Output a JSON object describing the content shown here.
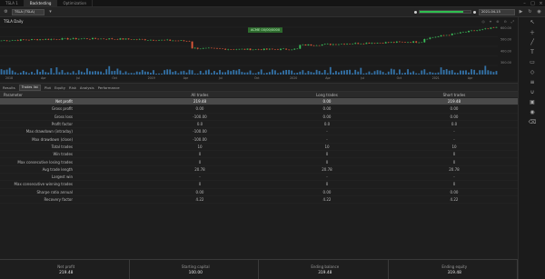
{
  "tabs": [
    {
      "label": "TSLA 1",
      "active": false
    },
    {
      "label": "Backtesting",
      "active": true
    },
    {
      "label": "Optimization",
      "active": false
    }
  ],
  "toolbar": {
    "symbol": "TSLA (TSLA)",
    "date": "2021-04-15",
    "progress": 0.85
  },
  "chart": {
    "title": "TSLA Daily",
    "tag": "ACME 00/00/0000",
    "controls": [
      "◎",
      "⌖",
      "⊕",
      "⊖",
      "⤢"
    ],
    "price_axis": [
      "600.00",
      "500.00",
      "400.00",
      "300.00"
    ],
    "time_axis": [
      "2018",
      "Apr",
      "Jul",
      "Oct",
      "2019",
      "Apr",
      "Jul",
      "Oct",
      "2020",
      "Apr",
      "Jul",
      "Oct",
      "2021",
      "Apr"
    ],
    "colors": {
      "up": "#3bbf5a",
      "down": "#e05a3a",
      "volume": "#3a87c9",
      "grid": "#2a2a2a"
    }
  },
  "results_toolbar": {
    "items": [
      "Results",
      "Trades list",
      "Plot",
      "Equity",
      "Risk",
      "Analysis",
      "Performance"
    ],
    "selected": "Trades list"
  },
  "table": {
    "headers": [
      "Parameter",
      "All trades",
      "Long trades",
      "Short trades"
    ],
    "rows": [
      {
        "label": "Net profit",
        "values": [
          "219.48",
          "0.00",
          "219.48"
        ],
        "indent": true,
        "selected": true
      },
      {
        "label": "Gross profit",
        "values": [
          "0.00",
          "0.00",
          "0.00"
        ],
        "indent": true
      },
      {
        "label": "Gross loss",
        "values": [
          "-100.00",
          "0.00",
          "0.00"
        ],
        "indent": true
      },
      {
        "label": "Profit factor",
        "values": [
          "0.0",
          "0.0",
          "0.0"
        ],
        "indent": true
      },
      {
        "label": "Max drawdown (intraday)",
        "values": [
          "-100.00",
          "-",
          "-"
        ],
        "indent": true
      },
      {
        "label": "Max drawdown (close)",
        "values": [
          "-100.00",
          "-",
          "-"
        ],
        "indent": true
      },
      {
        "label": "Total trades",
        "values": [
          "10",
          "10",
          "10"
        ],
        "indent": true
      },
      {
        "label": "Win trades",
        "values": [
          "0",
          "0",
          "0"
        ],
        "indent": true
      },
      {
        "label": "Max consecutive losing trades",
        "values": [
          "0",
          "0",
          "0"
        ],
        "indent": true
      },
      {
        "label": "Avg trade length",
        "values": [
          "20.78",
          "20.78",
          "20.78"
        ],
        "indent": true
      },
      {
        "label": "Largest win",
        "values": [
          "-",
          "-",
          "-"
        ],
        "indent": true
      },
      {
        "label": "Max consecutive winning trades",
        "values": [
          "0",
          "0",
          "0"
        ],
        "indent": true
      },
      {
        "label": "Sharpe ratio annual",
        "values": [
          "0.00",
          "0.00",
          "0.00"
        ],
        "indent": true
      },
      {
        "label": "Recovery factor",
        "values": [
          "4.22",
          "4.22",
          "4.22"
        ],
        "indent": true
      }
    ]
  },
  "summary": [
    {
      "label": "Net profit",
      "value": "219.48"
    },
    {
      "label": "Starting capital",
      "value": "100.00"
    },
    {
      "label": "Ending balance",
      "value": "319.48"
    },
    {
      "label": "Ending equity",
      "value": "319.48"
    }
  ],
  "rail_icons": [
    "cursor-icon",
    "crosshair-icon",
    "trendline-icon",
    "text-icon",
    "ruler-icon",
    "shapes-icon",
    "fibonacci-icon",
    "magnet-icon",
    "lock-icon",
    "eye-icon",
    "trash-icon"
  ],
  "window_controls": [
    "–",
    "□",
    "×"
  ]
}
